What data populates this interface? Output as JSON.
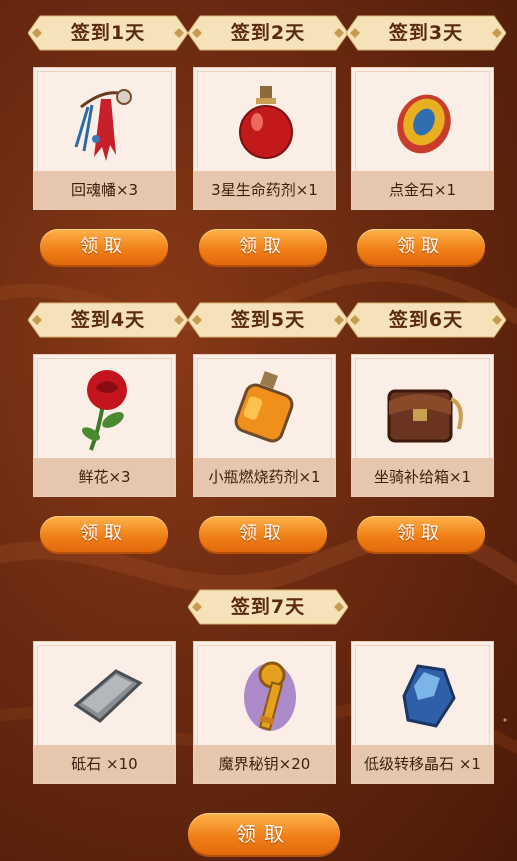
{
  "colors": {
    "background": "#6b2a10",
    "banner": "#f6e2b8",
    "card": "#fbeee6",
    "label_strip": "#e6c7ad",
    "button": "#ef7d15"
  },
  "days": [
    {
      "banner": "签到1天",
      "reward": "回魂幡×3",
      "icon": "banner-charm-icon",
      "claim": "领取"
    },
    {
      "banner": "签到2天",
      "reward": "3星生命药剂×1",
      "icon": "red-potion-icon",
      "claim": "领取"
    },
    {
      "banner": "签到3天",
      "reward": "点金石×1",
      "icon": "golden-stone-icon",
      "claim": "领取"
    },
    {
      "banner": "签到4天",
      "reward": "鲜花×3",
      "icon": "rose-icon",
      "claim": "领取"
    },
    {
      "banner": "签到5天",
      "reward": "小瓶燃烧药剂×1",
      "icon": "orange-potion-icon",
      "claim": "领取"
    },
    {
      "banner": "签到6天",
      "reward": "坐骑补给箱×1",
      "icon": "saddle-bag-icon",
      "claim": "领取"
    }
  ],
  "day7": {
    "banner": "签到7天",
    "rewards": [
      {
        "label": "砥石 ×10",
        "icon": "whetstone-icon"
      },
      {
        "label": "魔界秘钥×20",
        "icon": "demon-key-icon"
      },
      {
        "label": "低级转移晶石 ×1",
        "icon": "blue-crystal-icon"
      }
    ],
    "claim": "领取"
  }
}
